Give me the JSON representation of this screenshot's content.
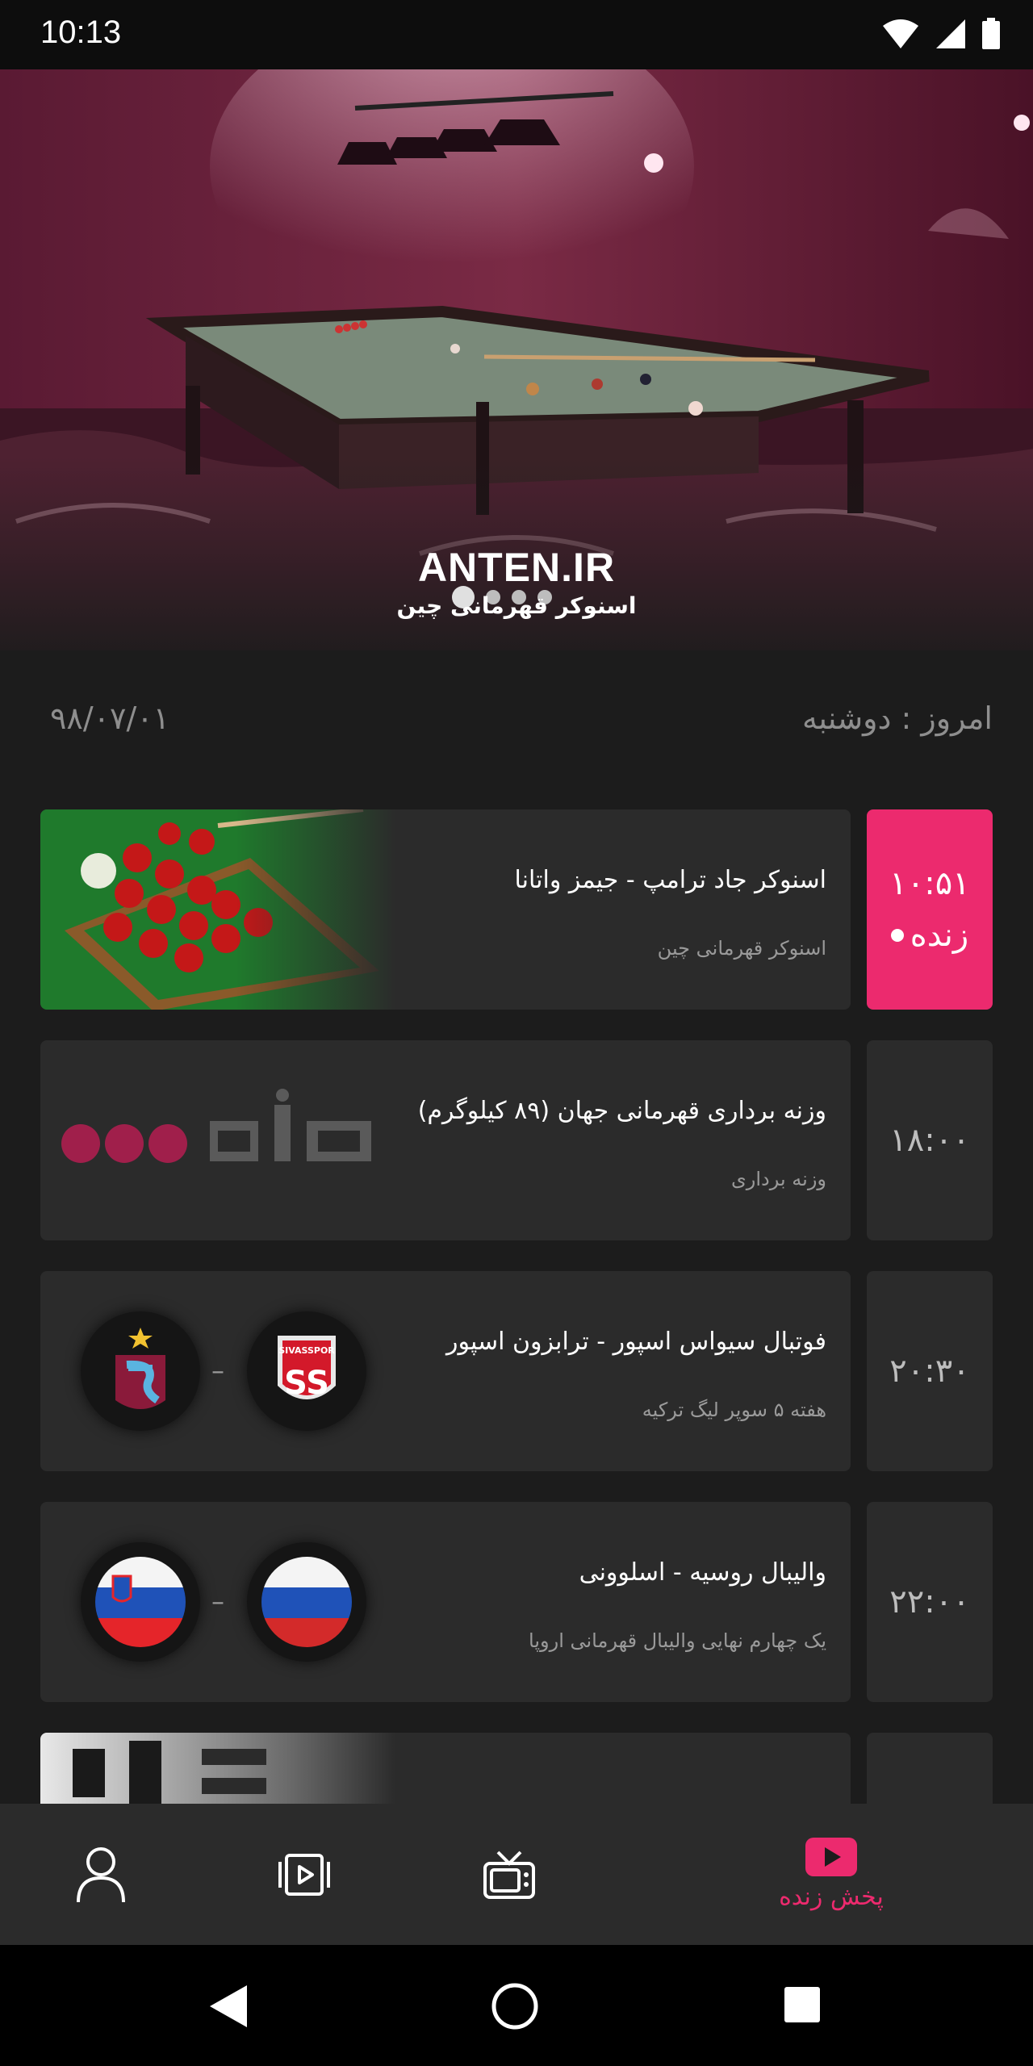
{
  "status_bar": {
    "time": "10:13"
  },
  "hero": {
    "logo": "ANTEN.IR",
    "subtitle": "اسنوکر قهرمانی چین"
  },
  "date_row": {
    "today_label": "امروز : دوشنبه",
    "date": "۹۸/۰۷/۰۱"
  },
  "schedule": [
    {
      "time": "۱۰:۵۱",
      "live_label": "زنده",
      "title": "اسنوکر جاد ترامپ - جیمز واتانا",
      "subtitle": "اسنوکر قهرمانی چین",
      "thumb": "snooker-image"
    },
    {
      "time": "۱۸:۰۰",
      "title": "وزنه برداری قهرمانی جهان (۸۹ کیلوگرم)",
      "subtitle": "وزنه برداری",
      "thumb": "anten-logo"
    },
    {
      "time": "۲۰:۳۰",
      "title": "فوتبال سیواس اسپور - ترابزون اسپور",
      "subtitle": "هفته ۵ سوپر لیگ ترکیه",
      "vs": "–",
      "home_team": "sivasspor-logo",
      "away_team": "trabzonspor-logo"
    },
    {
      "time": "۲۲:۰۰",
      "title": "والیبال روسیه - اسلوونی",
      "subtitle": "یک چهارم نهایی والیبال قهرمانی اروپا",
      "vs": "–",
      "home_team": "russia-flag",
      "away_team": "slovenia-flag"
    }
  ],
  "bottom_nav": {
    "live_label": "پخش زنده",
    "items": [
      "profile-icon",
      "videos-icon",
      "tv-icon",
      "live-icon"
    ]
  },
  "colors": {
    "accent": "#ec2a6e",
    "card": "#2b2b2b",
    "background": "#1c1c1c"
  }
}
